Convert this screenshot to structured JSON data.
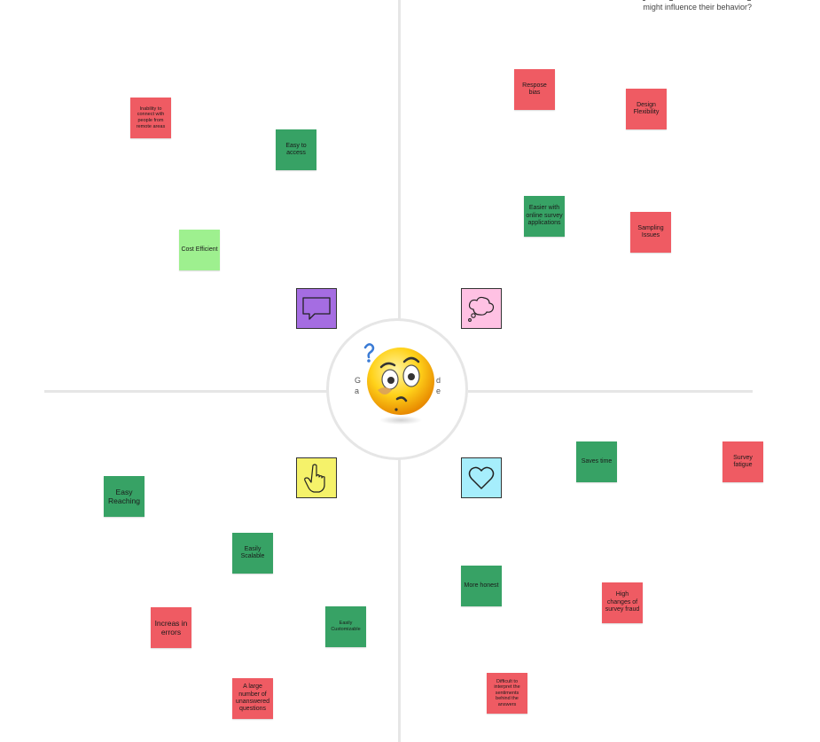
{
  "board": {
    "top_prompt_line": "might influence their behavior?",
    "center_letters": {
      "left_top": "G",
      "left_bottom": "a",
      "right_top": "d",
      "right_bottom": "e"
    }
  },
  "quadrant_icons": {
    "says": {
      "icon": "speech-bubble-icon",
      "color": "#a56de2"
    },
    "thinks": {
      "icon": "thought-bubble-icon",
      "color": "#ffc1e3"
    },
    "does": {
      "icon": "pointing-hand-icon",
      "color": "#f5f26a"
    },
    "feels": {
      "icon": "heart-icon",
      "color": "#a6eefc"
    },
    "center": {
      "icon": "confused-face-icon"
    }
  },
  "notes": {
    "inability_remote": "Inability to connect with people from remote areas",
    "easy_access": "Easy to access",
    "cost_efficient": "Cost Efficient",
    "response_bias": "Respose bias",
    "design_flexibility": "Design Flexibility",
    "easier_online": "Easier with online survey applications",
    "sampling_issues": "Sampling Issues",
    "easy_reaching": "Easy Reaching",
    "easily_scalable": "Easily Scalable",
    "increase_errors": "Increas in errors",
    "easily_customizable": "Easily Customizable",
    "large_unanswered": "A large number of unanswered questions",
    "saves_time": "Saves time",
    "survey_fatigue": "Survey fatigue",
    "more_honest": "More honest",
    "high_fraud": "High changes of survey fraud",
    "difficult_sentiments": "Difficult to interpret the sentiments behind the answers"
  },
  "colors": {
    "red": "#ef5b63",
    "green": "#37a265",
    "light_green": "#9ef08f",
    "divider": "#e6e6e6"
  }
}
